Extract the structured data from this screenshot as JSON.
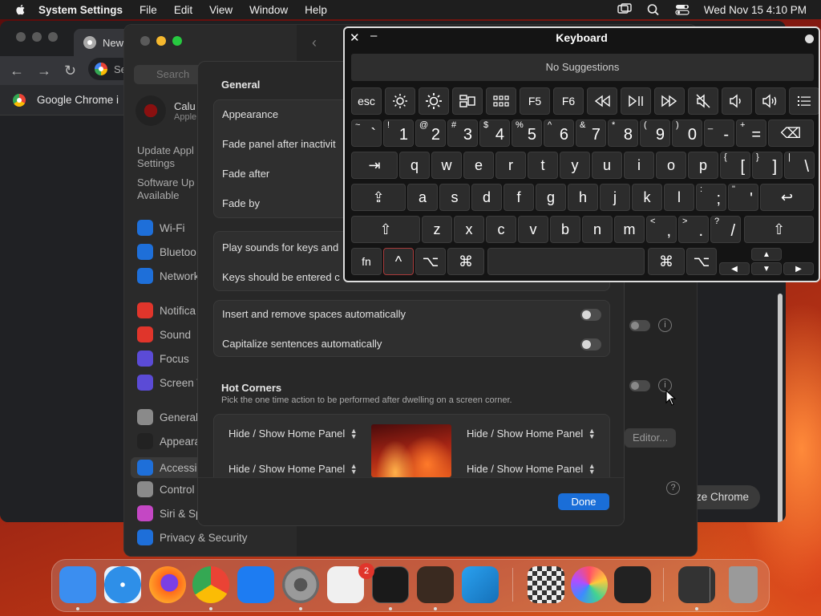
{
  "menubar": {
    "app": "System Settings",
    "items": [
      "File",
      "Edit",
      "View",
      "Window",
      "Help"
    ],
    "clock": "Wed Nov 15  4:10 PM"
  },
  "chrome": {
    "tab_title": "New",
    "omnibox_text": "Se",
    "bookmark_label": "Google Chrome i",
    "customize_label": "ze Chrome"
  },
  "settings": {
    "search_placeholder": "Search",
    "profile_name": "Calu",
    "profile_sub": "Apple",
    "update_link": "Update Appl Settings",
    "update_line1": "Update Appl",
    "update_line2": "Settings",
    "software_line1": "Software Up",
    "software_line2": "Available",
    "sidebar_items": [
      {
        "label": "Wi-Fi",
        "color": "#1e6fd9"
      },
      {
        "label": "Bluetoo",
        "color": "#1e6fd9"
      },
      {
        "label": "Network",
        "color": "#1e6fd9"
      },
      {
        "label": "Notifica",
        "color": "#e0352b"
      },
      {
        "label": "Sound",
        "color": "#e0352b"
      },
      {
        "label": "Focus",
        "color": "#5b4bd6"
      },
      {
        "label": "Screen T",
        "color": "#5b4bd6"
      },
      {
        "label": "General",
        "color": "#8a8a8a"
      },
      {
        "label": "Appeara",
        "color": "#222222"
      },
      {
        "label": "Accessi",
        "color": "#1e6fd9"
      },
      {
        "label": "Control",
        "color": "#8a8a8a"
      },
      {
        "label": "Siri & Sp",
        "color": "#c447c4"
      },
      {
        "label": "Privacy & Security",
        "color": "#1e6fd9"
      }
    ],
    "editor_button": "Editor..."
  },
  "sheet": {
    "section_general": "General",
    "rows_general": [
      "Appearance",
      "Fade panel after inactivit",
      "Fade after",
      "Fade by"
    ],
    "rows_sounds": [
      "Play sounds for keys and",
      "Keys should be entered c"
    ],
    "toggle_rows": [
      "Insert and remove spaces automatically",
      "Capitalize sentences automatically"
    ],
    "hot_corners_title": "Hot Corners",
    "hot_corners_sub": "Pick the one time action to be performed after dwelling on a screen corner.",
    "corner_labels": [
      "Hide / Show Home Panel",
      "Hide / Show Home Panel",
      "Hide / Show Home Panel",
      "Hide / Show Home Panel"
    ],
    "done_label": "Done"
  },
  "keyboard": {
    "title": "Keyboard",
    "suggestions": "No Suggestions",
    "fn_keys": [
      "esc",
      "brightness-down-icon",
      "brightness-up-icon",
      "mission-control-icon",
      "launchpad-icon",
      "F5",
      "F6",
      "rewind-icon",
      "play-pause-icon",
      "fast-forward-icon",
      "mute-icon",
      "volume-down-icon",
      "volume-up-icon",
      "list-icon"
    ],
    "number_row": [
      {
        "top": "~",
        "bottom": "`"
      },
      {
        "top": "!",
        "bottom": "1"
      },
      {
        "top": "@",
        "bottom": "2"
      },
      {
        "top": "#",
        "bottom": "3"
      },
      {
        "top": "$",
        "bottom": "4"
      },
      {
        "top": "%",
        "bottom": "5"
      },
      {
        "top": "^",
        "bottom": "6"
      },
      {
        "top": "&",
        "bottom": "7"
      },
      {
        "top": "*",
        "bottom": "8"
      },
      {
        "top": "(",
        "bottom": "9"
      },
      {
        "top": ")",
        "bottom": "0"
      },
      {
        "top": "_",
        "bottom": "-"
      },
      {
        "top": "+",
        "bottom": "="
      }
    ],
    "row_q": [
      "q",
      "w",
      "e",
      "r",
      "t",
      "y",
      "u",
      "i",
      "o",
      "p"
    ],
    "row_q_extra": [
      {
        "top": "{",
        "bottom": "["
      },
      {
        "top": "}",
        "bottom": "]"
      },
      {
        "top": "|",
        "bottom": "\\"
      }
    ],
    "row_a": [
      "a",
      "s",
      "d",
      "f",
      "g",
      "h",
      "j",
      "k",
      "l"
    ],
    "row_a_extra": [
      {
        "top": ":",
        "bottom": ";"
      },
      {
        "top": "\"",
        "bottom": "'"
      }
    ],
    "row_z": [
      "z",
      "x",
      "c",
      "v",
      "b",
      "n",
      "m"
    ],
    "row_z_extra": [
      {
        "top": "<",
        "bottom": ","
      },
      {
        "top": ">",
        "bottom": "."
      },
      {
        "top": "?",
        "bottom": "/"
      }
    ],
    "fn_label": "fn",
    "tab": "⇥",
    "caps": "⇪",
    "shift": "⇧",
    "return": "↩",
    "delete": "⌫",
    "ctrl": "^",
    "option": "⌥",
    "command": "⌘",
    "arrows": [
      "▲",
      "◀",
      "▼",
      "▶"
    ]
  },
  "dock": {
    "badge": "2",
    "apps": [
      {
        "name": "finder-icon",
        "color": "#3b8ef0"
      },
      {
        "name": "safari-icon",
        "color": "#2e8fe8"
      },
      {
        "name": "firefox-icon",
        "color": "#ff6a1a"
      },
      {
        "name": "chrome-icon",
        "color": "#e8e8e8"
      },
      {
        "name": "app-store-icon",
        "color": "#1d7cf2"
      },
      {
        "name": "system-settings-icon",
        "color": "#8a8a8a"
      },
      {
        "name": "textedit-icon",
        "color": "#f0f0f0"
      },
      {
        "name": "terminal-icon",
        "color": "#1a1a1a"
      },
      {
        "name": "garageband-icon",
        "color": "#3a2a20"
      },
      {
        "name": "vscode-icon",
        "color": "#1f8ad2"
      },
      {
        "name": "chess-icon",
        "color": "#bbbbbb"
      },
      {
        "name": "pixelmator-icon",
        "color": "#2a2a3a"
      },
      {
        "name": "screen-recorder-icon",
        "color": "#222222"
      },
      {
        "name": "screenshot-icon",
        "color": "#333333"
      },
      {
        "name": "trash-icon",
        "color": "#9a9a9a"
      }
    ]
  }
}
